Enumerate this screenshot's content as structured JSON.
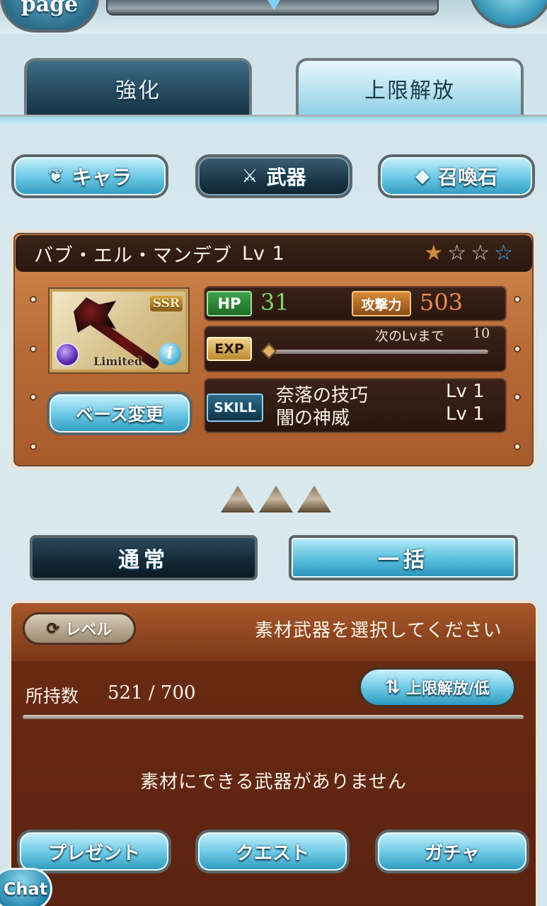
{
  "header": {
    "page_badge": "page"
  },
  "tabs": [
    {
      "label": "強化",
      "active": false
    },
    {
      "label": "上限解放",
      "active": true
    }
  ],
  "categories": [
    {
      "label": "キャラ",
      "icon": "character-emblem-icon",
      "active": false
    },
    {
      "label": "武器",
      "icon": "crossed-weapons-icon",
      "active": true
    },
    {
      "label": "召喚石",
      "icon": "summon-crystal-icon",
      "active": false
    }
  ],
  "weapon": {
    "name": "バブ・エル・マンデブ",
    "level_text": "Lv 1",
    "uncap_stars": {
      "filled": 1,
      "empty": 2,
      "blue": 1
    },
    "rarity_badge": "SSR",
    "tag": "Limited",
    "hp_label": "HP",
    "hp_value": "31",
    "atk_label": "攻撃力",
    "atk_value": "503",
    "exp_label": "EXP",
    "next_level_label": "次のLvまで",
    "next_level_value": "10",
    "exp_progress": 0,
    "skill_label": "SKILL",
    "skills": [
      {
        "name": "奈落の技巧",
        "level": "Lv 1"
      },
      {
        "name": "闇の神威",
        "level": "Lv 1"
      }
    ],
    "base_change_button": "ベース変更"
  },
  "modes": {
    "normal": "通常",
    "bulk": "一括"
  },
  "materials": {
    "level_sort_button": "レベル",
    "instruction": "素材武器を選択してください",
    "count_label": "所持数",
    "count_value": "521 / 700",
    "sort_button": "上限解放/低",
    "empty_message": "素材にできる武器がありません"
  },
  "bottom_nav": [
    {
      "label": "プレゼント"
    },
    {
      "label": "クエスト"
    },
    {
      "label": "ガチャ"
    }
  ],
  "chat_button": "Chat",
  "colors": {
    "panel_brown": "#b86a36",
    "button_blue": "#6fcbe6",
    "hp_green": "#7ad96a",
    "atk_orange": "#f08a4a"
  }
}
